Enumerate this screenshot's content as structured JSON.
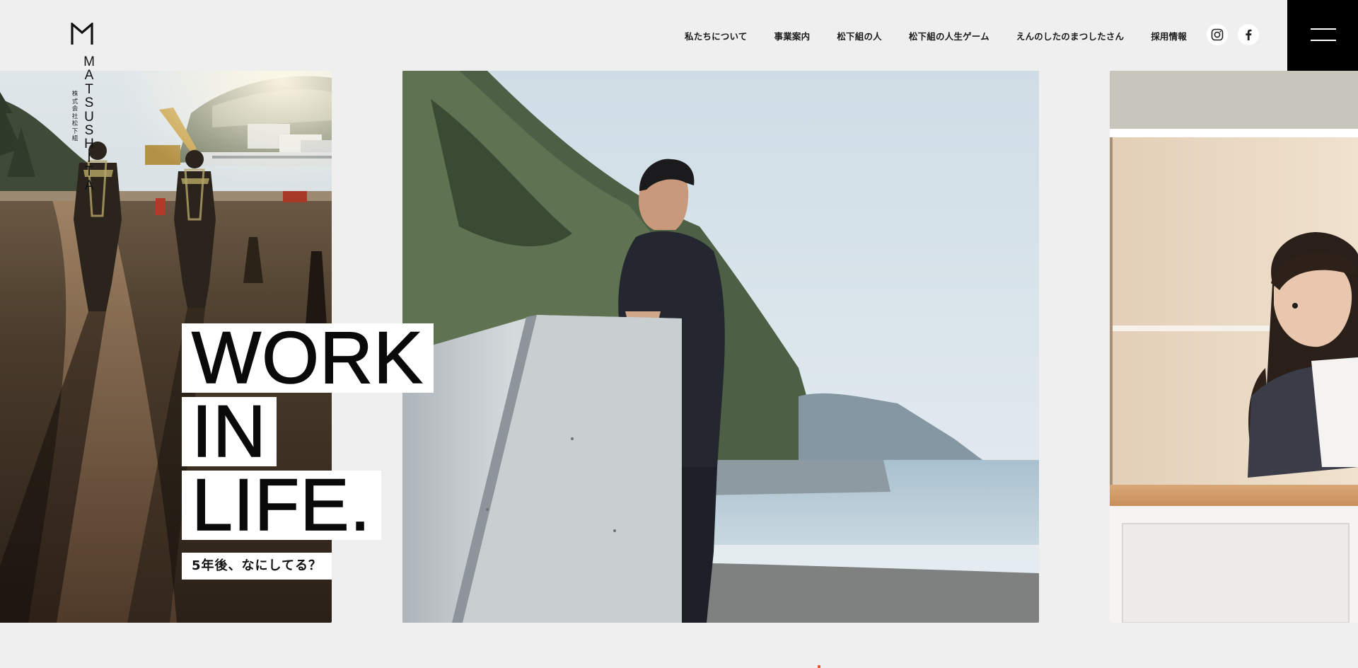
{
  "logo": {
    "name_en_letters": [
      "M",
      "A",
      "T",
      "S",
      "U",
      "S",
      "H",
      "I",
      "T",
      "A"
    ],
    "name_jp_chars": [
      "株",
      "式",
      "会",
      "社",
      "松",
      "下",
      "組"
    ],
    "mark_icon": "m-monogram-icon"
  },
  "nav": {
    "items": [
      {
        "label": "私たちについて"
      },
      {
        "label": "事業案内"
      },
      {
        "label": "松下組の人"
      },
      {
        "label": "松下組の人生ゲーム"
      },
      {
        "label": "えんのしたのまつしたさん"
      },
      {
        "label": "採用情報"
      }
    ],
    "social": [
      {
        "icon": "instagram-icon"
      },
      {
        "icon": "facebook-icon"
      }
    ],
    "menu_icon": "hamburger-menu-icon"
  },
  "hero": {
    "line1": "WORK",
    "line2": "IN",
    "line3": "LIFE.",
    "subcopy": "5年後、なにしてる？"
  },
  "slides": [
    {
      "icon": "construction-site-photo"
    },
    {
      "icon": "man-by-sea-photo"
    },
    {
      "icon": "smiling-woman-photo"
    }
  ],
  "colors": {
    "background": "#efefef",
    "menu_button": "#000000",
    "hero_box": "#ffffff",
    "accent": "#e8582a"
  }
}
